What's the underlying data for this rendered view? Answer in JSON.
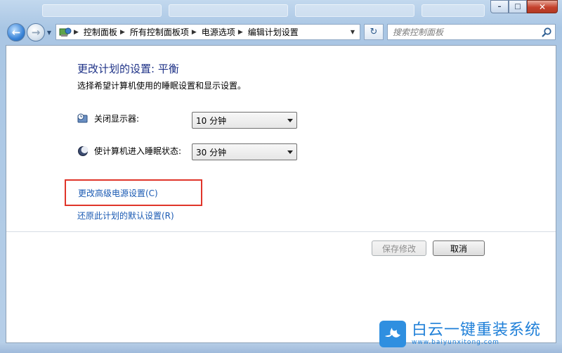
{
  "window": {
    "minimize_glyph": "–",
    "maximize_glyph": "□",
    "close_glyph": "✕"
  },
  "nav": {
    "back_glyph": "←",
    "forward_glyph": "→",
    "breadcrumbs": [
      "控制面板",
      "所有控制面板项",
      "电源选项",
      "编辑计划设置"
    ],
    "crumb_separator": "▶",
    "refresh_glyph": "↻"
  },
  "search": {
    "placeholder": "搜索控制面板"
  },
  "main": {
    "title": "更改计划的设置: 平衡",
    "subtitle": "选择希望计算机使用的睡眠设置和显示设置。",
    "settings": [
      {
        "label": "关闭显示器:",
        "value": "10 分钟",
        "icon": "monitor-clock-icon"
      },
      {
        "label": "使计算机进入睡眠状态:",
        "value": "30 分钟",
        "icon": "moon-icon"
      }
    ],
    "links": {
      "advanced": "更改高级电源设置(C)",
      "restore": "还原此计划的默认设置(R)"
    },
    "buttons": {
      "save": "保存修改",
      "cancel": "取消"
    }
  },
  "highlight_color": "#e0352a",
  "watermark": {
    "brand": "白云一键重装系统",
    "url": "www.baiyunxitong.com"
  }
}
